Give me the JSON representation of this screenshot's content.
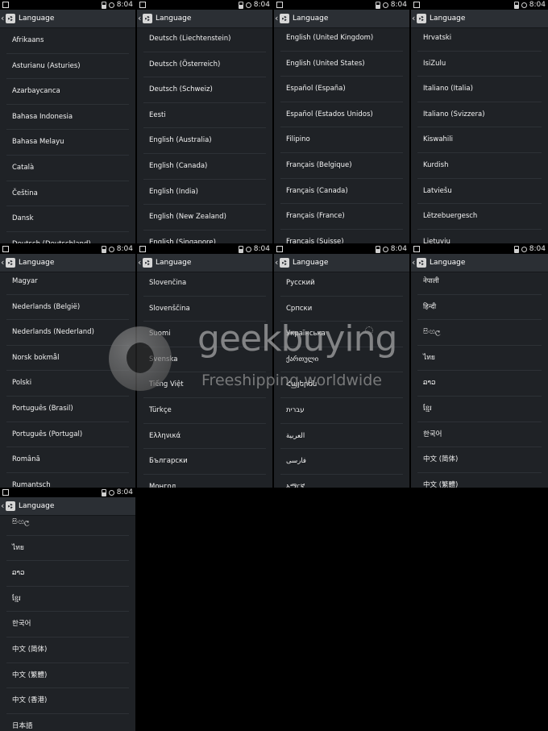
{
  "status": {
    "time": "8:04"
  },
  "header": {
    "title": "Language",
    "back": "‹"
  },
  "watermark": {
    "brand": "geekbuying",
    "tagline": "Freeshipping worldwide"
  },
  "panels": [
    {
      "items": [
        "Afrikaans",
        "Asturianu (Asturies)",
        "Azarbaycanca",
        "Bahasa Indonesia",
        "Bahasa Melayu",
        "Català",
        "Čeština",
        "Dansk",
        "Deutsch (Deutschland)"
      ]
    },
    {
      "items": [
        "Deutsch (Liechtenstein)",
        "Deutsch (Österreich)",
        "Deutsch (Schweiz)",
        "Eesti",
        "English (Australia)",
        "English (Canada)",
        "English (India)",
        "English (New Zealand)",
        "English (Singapore)"
      ]
    },
    {
      "items": [
        "English (United Kingdom)",
        "English (United States)",
        "Español (España)",
        "Español (Estados Unidos)",
        "Filipino",
        "Français (Belgique)",
        "Français (Canada)",
        "Français (France)",
        "Français (Suisse)"
      ]
    },
    {
      "items": [
        "Hrvatski",
        "IsiZulu",
        "Italiano (Italia)",
        "Italiano (Svizzera)",
        "Kiswahili",
        "Kurdish",
        "Latviešu",
        "Lëtzebuergesch",
        "Lietuvių"
      ]
    },
    {
      "items": [
        "Magyar",
        "Nederlands (België)",
        "Nederlands (Nederland)",
        "Norsk bokmål",
        "Polski",
        "Português (Brasil)",
        "Português (Portugal)",
        "Română",
        "Rumantsch"
      ]
    },
    {
      "items": [
        "Slovenčina",
        "Slovenščina",
        "Suomi",
        "Svenska",
        "Tiếng Việt",
        "Türkçe",
        "Ελληνικά",
        "Български",
        "Монгол"
      ]
    },
    {
      "items": [
        "Русский",
        "Српски",
        "Українська",
        "ქართული",
        "Հայերեն",
        "עברית",
        "العربية",
        "فارسی",
        "አማርኛ"
      ]
    },
    {
      "items": [
        "नेपाली",
        "हिन्दी",
        "සිංහල",
        "ไทย",
        "ລາວ",
        "ខ្មែរ",
        "한국어",
        "中文 (简体)",
        "中文 (繁體)"
      ]
    },
    {
      "items": [
        "සිංහල",
        "ไทย",
        "ລາວ",
        "ខ្មែរ",
        "한국어",
        "中文 (简体)",
        "中文 (繁體)",
        "中文 (香港)",
        "日本語"
      ]
    }
  ]
}
